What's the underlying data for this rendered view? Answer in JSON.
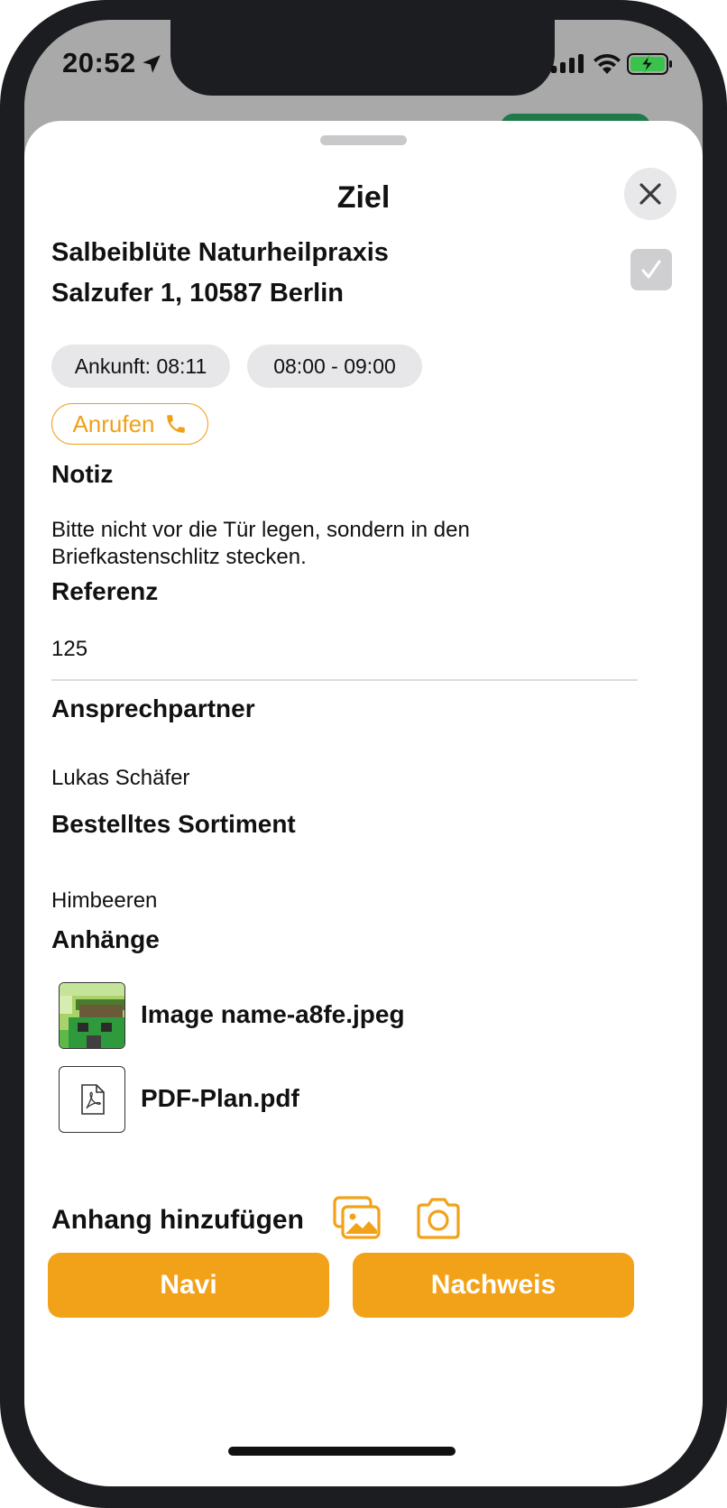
{
  "status_bar": {
    "time": "20:52",
    "location_icon": "location-arrow-icon",
    "signal_icon": "cellular-signal-icon",
    "wifi_icon": "wifi-icon",
    "battery_icon": "battery-charging-icon"
  },
  "sheet": {
    "title": "Ziel",
    "close_icon": "close-icon",
    "done_checked": true
  },
  "destination": {
    "name": "Salbeiblüte Naturheilpraxis",
    "address": "Salzufer 1, 10587 Berlin",
    "arrival": "Ankunft: 08:11",
    "time_window": "08:00 - 09:00",
    "call_label": "Anrufen"
  },
  "sections": {
    "note_heading": "Notiz",
    "note_line1": "Bitte nicht vor die Tür legen, sondern in den",
    "note_line2": "Briefkastenschlitz stecken.",
    "reference_heading": "Referenz",
    "reference_value": "125",
    "contact_heading": "Ansprechpartner",
    "contact_value": "Lukas Schäfer",
    "assortment_heading": "Bestelltes Sortiment",
    "assortment_value": "Himbeeren",
    "attachments_heading": "Anhänge"
  },
  "attachments": [
    {
      "name": "Image name-a8fe.jpeg",
      "icon": "image-thumbnail"
    },
    {
      "name": "PDF-Plan.pdf",
      "icon": "pdf-icon"
    }
  ],
  "add_attachment": {
    "label": "Anhang hinzufügen",
    "gallery_icon": "photo-gallery-icon",
    "camera_icon": "camera-icon"
  },
  "actions": {
    "navi_label": "Navi",
    "proof_label": "Nachweis"
  },
  "colors": {
    "accent": "#f2a218",
    "accent_outline": "#f0a01a",
    "chip_bg": "#e7e7e9",
    "backdrop": "#a9a9a9",
    "green_button": "#1e7a4a"
  }
}
